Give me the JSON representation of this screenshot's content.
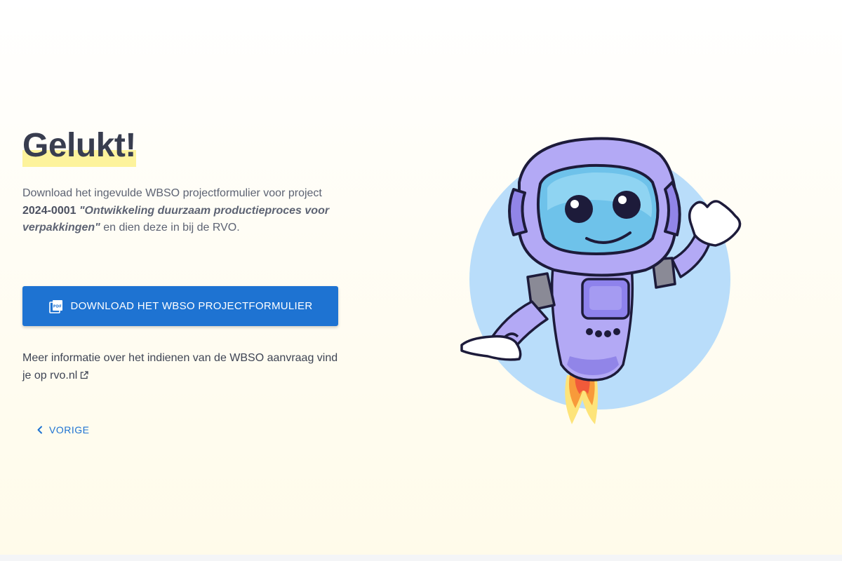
{
  "page": {
    "title": "Gelukt!",
    "intro": {
      "text_before": "Download het ingevulde WBSO projectformulier voor project ",
      "project_number": "2024-0001",
      "project_title": "\"Ontwikkeling duurzaam productieproces voor verpakkingen\"",
      "text_after": " en dien deze in bij de RVO."
    },
    "download_button": {
      "label": "DOWNLOAD HET WBSO PROJECTFORMULIER",
      "icon": "pdf-file-icon"
    },
    "more_info": {
      "text": "Meer informatie over het indienen van de WBSO aanvraag vind je op ",
      "link_label": "rvo.nl",
      "icon": "external-link-icon"
    },
    "back_button": {
      "label": "VORIGE",
      "icon": "chevron-left-icon"
    },
    "illustration": {
      "icon": "robot-waving-illustration",
      "pdf_badge": "PDF"
    }
  },
  "colors": {
    "primary": "#1e73d2",
    "highlight": "#fdf39c",
    "title": "#383d4f",
    "robot_body": "#b3a9f5",
    "circle": "#b9ddfa"
  }
}
